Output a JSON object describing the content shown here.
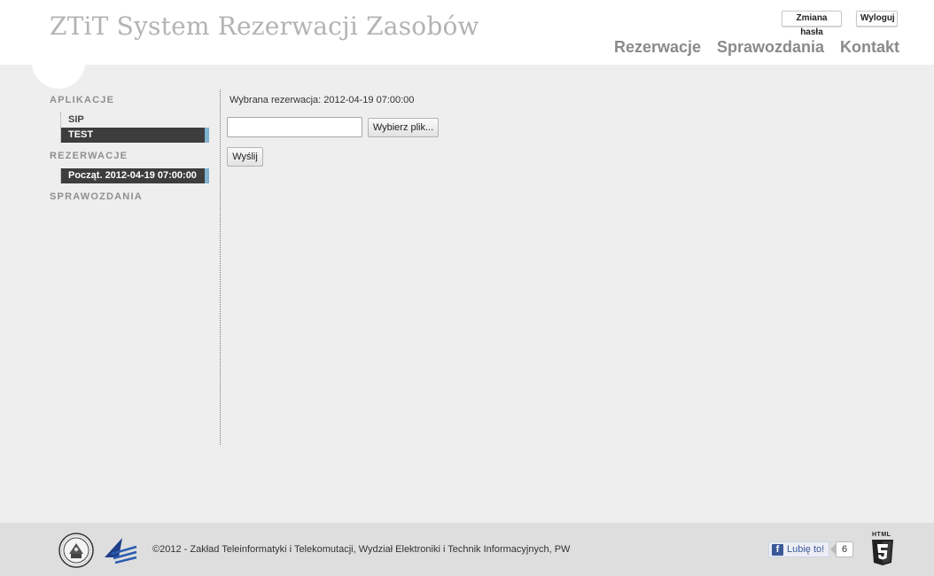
{
  "header": {
    "title": "ZTiT System Rezerwacji Zasobów",
    "buttons": {
      "change_password": "Zmiana hasła",
      "logout": "Wyloguj"
    },
    "nav": [
      "Rezerwacje",
      "Sprawozdania",
      "Kontakt"
    ]
  },
  "sidebar": {
    "sections": [
      {
        "title": "APLIKACJE",
        "items": [
          "SIP",
          "TEST"
        ],
        "active": "TEST"
      },
      {
        "title": "REZERWACJE",
        "items": [
          "Począt. 2012-04-19 07:00:00"
        ],
        "active": "Począt. 2012-04-19 07:00:00"
      },
      {
        "title": "SPRAWOZDANIA",
        "items": []
      }
    ]
  },
  "main": {
    "selected_reservation": "Wybrana rezerwacja: 2012-04-19 07:00:00",
    "file_input_value": "",
    "choose_file_label": "Wybierz plik...",
    "send_label": "Wyślij"
  },
  "footer": {
    "copyright": "©2012 - Zakład Teleinformatyki i Telekomutacji, Wydział Elektroniki i Technik Informacyjnych, PW",
    "like_label": "Lubię to!",
    "like_count": "6",
    "html5_label": "HTML"
  },
  "colors": {
    "active_item_bg": "#3d3d3d",
    "active_item_accent": "#7fb2d0",
    "facebook": "#3b5998"
  }
}
